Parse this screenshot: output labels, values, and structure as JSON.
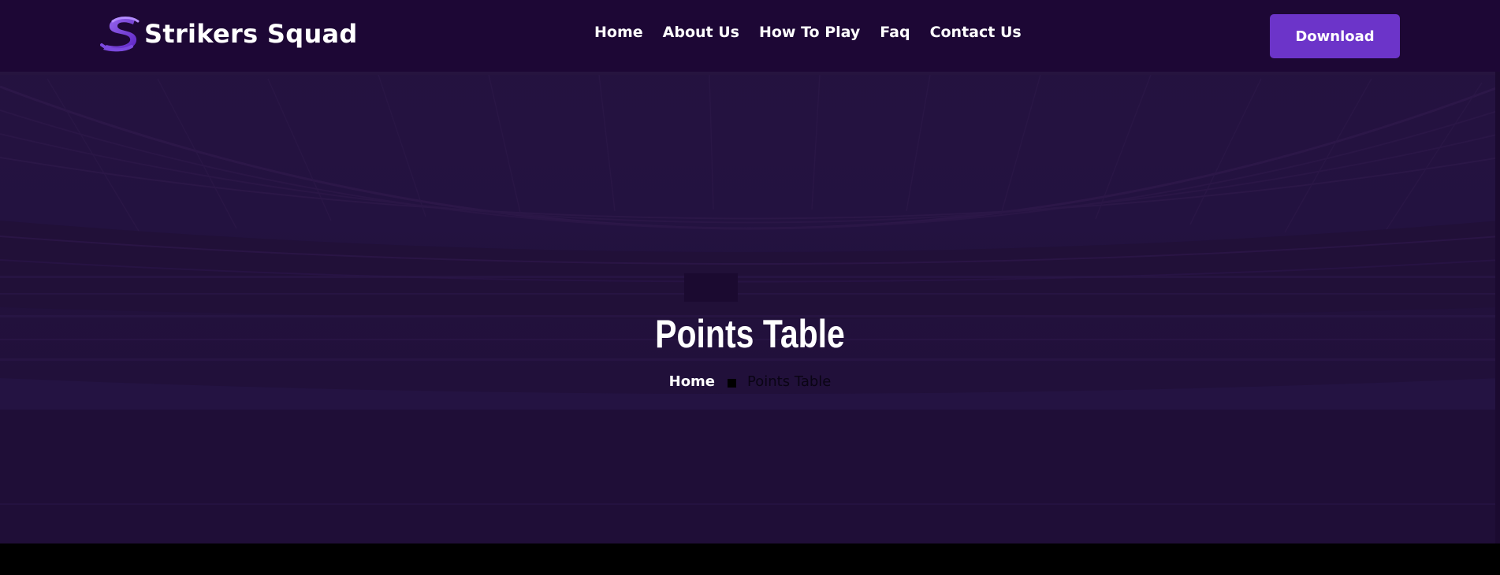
{
  "header": {
    "brand": "Strikers Squad",
    "nav": [
      "Home",
      "About Us",
      "How To Play",
      "Faq",
      "Contact Us"
    ],
    "download_label": "Download"
  },
  "hero": {
    "title": "Points Table",
    "breadcrumb": {
      "home": "Home",
      "current": "Points Table"
    }
  },
  "colors": {
    "header_bg": "#1d0735",
    "hero_bg": "#231240",
    "accent": "#6c34c9",
    "text": "#ffffff"
  },
  "icons": {
    "logo": "strikers-squad-logo-icon",
    "separator": "square-separator-icon"
  }
}
